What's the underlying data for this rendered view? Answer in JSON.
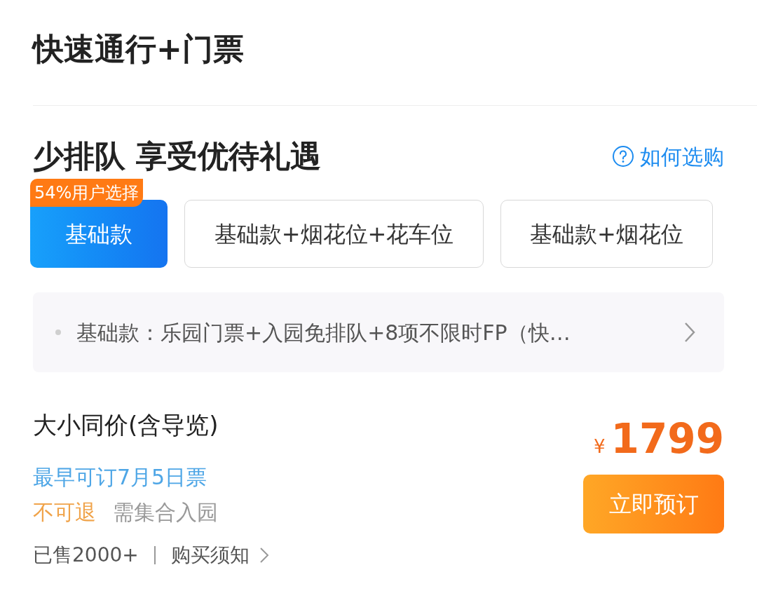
{
  "title": "快速通行+门票",
  "section": {
    "heading": "少排队 享受优待礼遇",
    "help_link": "如何选购"
  },
  "options": [
    {
      "label": "基础款",
      "selected": true,
      "badge": "54%用户选择"
    },
    {
      "label": "基础款+烟花位+花车位",
      "selected": false
    },
    {
      "label": "基础款+烟花位",
      "selected": false
    }
  ],
  "description": "基础款：乐园门票+入园免排队+8项不限时FP（快…",
  "product": {
    "name": "大小同价(含导览)",
    "availability": "最早可订7月5日票",
    "tags": [
      {
        "label": "不可退",
        "kind": "warning"
      },
      {
        "label": "需集合入园",
        "kind": "plain"
      }
    ],
    "sold": "已售2000+",
    "notice_link": "购买须知",
    "currency": "¥",
    "price": "1799",
    "book_button": "立即预订"
  }
}
